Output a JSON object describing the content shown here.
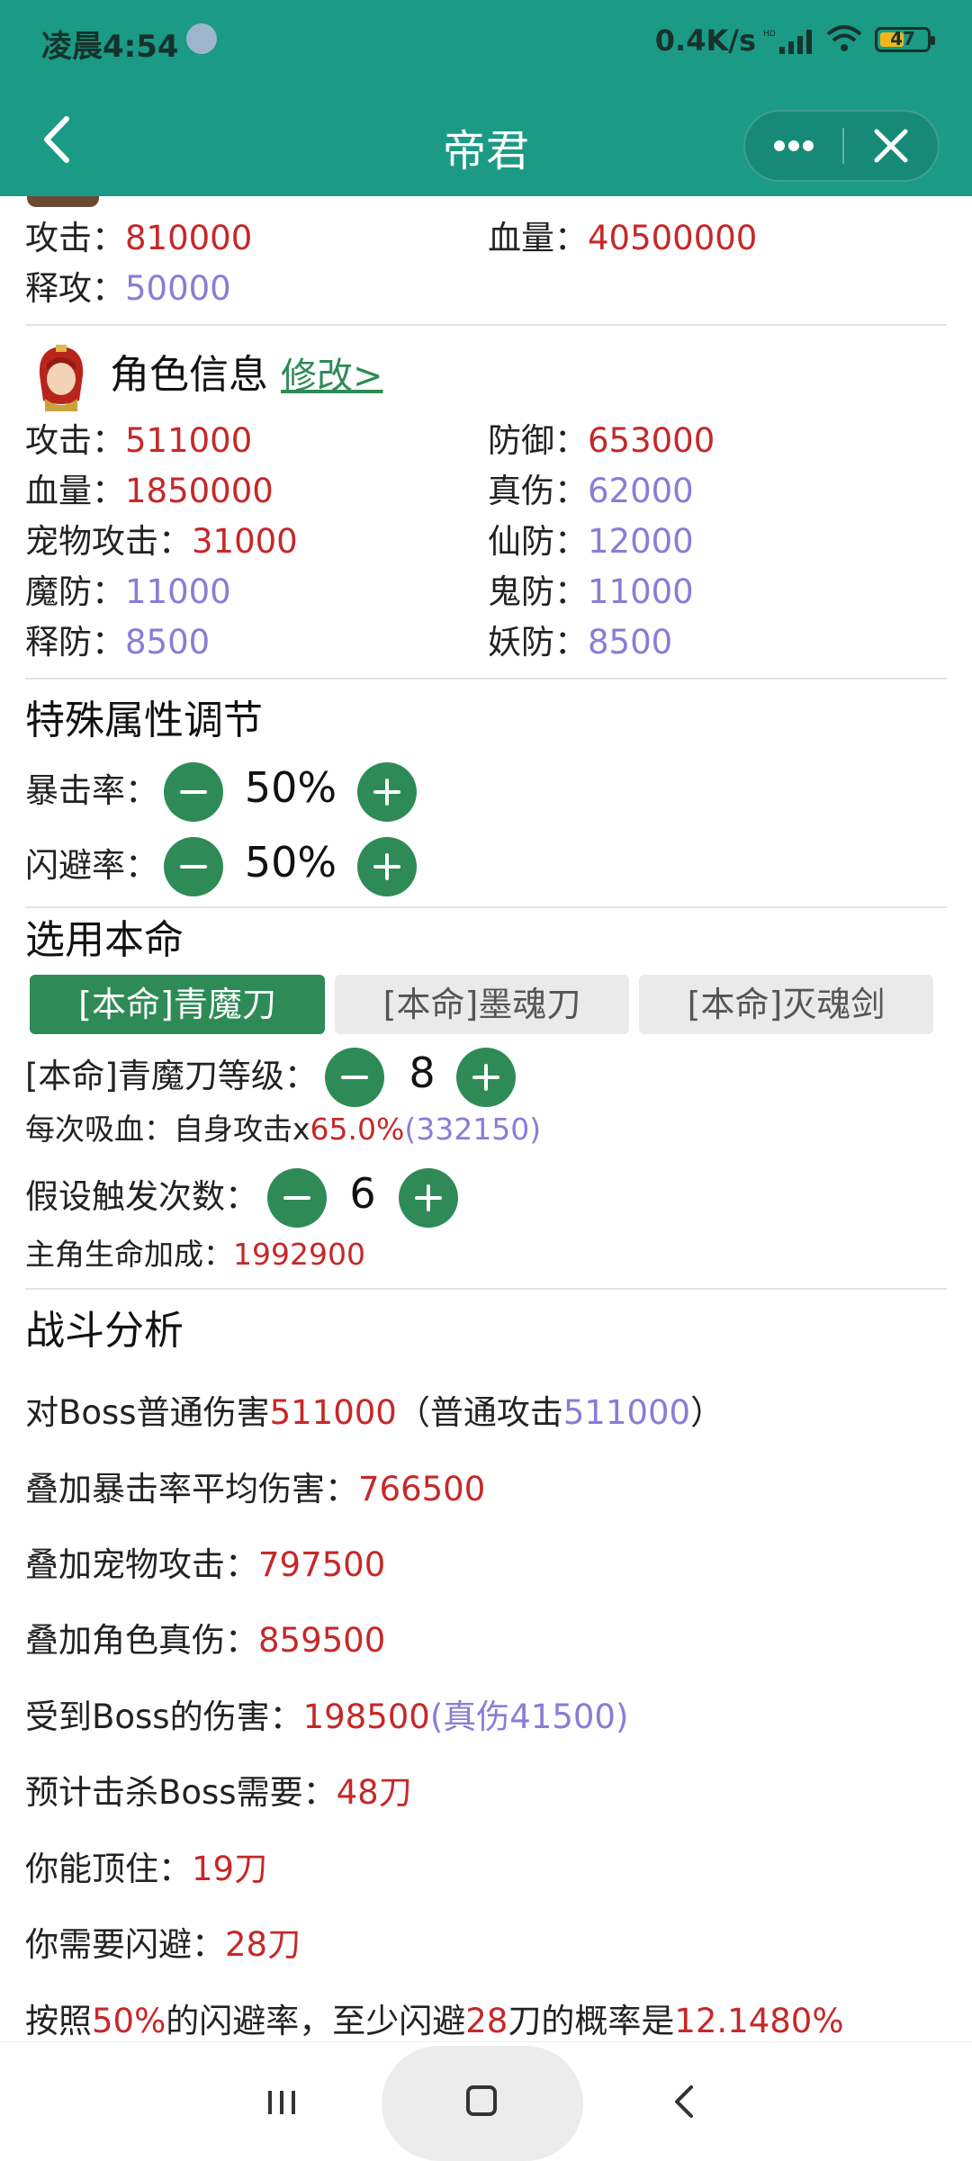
{
  "status": {
    "time": "凌晨4:54",
    "speed": "0.4K/s",
    "battery": "47",
    "network_badge": "HD"
  },
  "titlebar": {
    "title": "帝君"
  },
  "boss": {
    "attack_label": "攻击：",
    "attack": "810000",
    "hp_label": "血量：",
    "hp": "40500000",
    "release_label": "释攻：",
    "release": "50000"
  },
  "role": {
    "title": "角色信息",
    "edit": "修改>",
    "stats": {
      "attack_label": "攻击：",
      "attack": "511000",
      "defense_label": "防御：",
      "defense": "653000",
      "hp_label": "血量：",
      "hp": "1850000",
      "true_dmg_label": "真伤：",
      "true_dmg": "62000",
      "pet_attack_label": "宠物攻击：",
      "pet_attack": "31000",
      "immortal_def_label": "仙防：",
      "immortal_def": "12000",
      "magic_def_label": "魔防：",
      "magic_def": "11000",
      "ghost_def_label": "鬼防：",
      "ghost_def": "11000",
      "release_def_label": "释防：",
      "release_def": "8500",
      "demon_def_label": "妖防：",
      "demon_def": "8500"
    }
  },
  "special": {
    "title": "特殊属性调节",
    "crit_label": "暴击率：",
    "crit_value": "50%",
    "dodge_label": "闪避率：",
    "dodge_value": "50%"
  },
  "benming": {
    "title": "选用本命",
    "tabs": [
      "[本命]青魔刀",
      "[本命]墨魂刀",
      "[本命]灭魂剑"
    ],
    "level_label": "[本命]青魔刀等级：",
    "level": "8",
    "lifesteal_prefix": "每次吸血：自身攻击x",
    "lifesteal_pct": "65.0%",
    "lifesteal_amount": "(332150)",
    "trigger_label": "假设触发次数：",
    "trigger": "6",
    "bonus_label": "主角生命加成：",
    "bonus": "1992900"
  },
  "analysis": {
    "title": "战斗分析",
    "l1_a": "对Boss普通伤害",
    "l1_v": "511000",
    "l1_b": "（普通攻击",
    "l1_v2": "511000",
    "l1_c": "）",
    "l2_label": "叠加暴击率平均伤害：",
    "l2_v": "766500",
    "l3_label": "叠加宠物攻击：",
    "l3_v": "797500",
    "l4_label": "叠加角色真伤：",
    "l4_v": "859500",
    "l5_label": "受到Boss的伤害：",
    "l5_v": "198500",
    "l5_extra": "(真伤41500)",
    "l6_label": "预计击杀Boss需要：",
    "l6_v": "48刀",
    "l7_label": "你能顶住：",
    "l7_v": "19刀",
    "l8_label": "你需要闪避：",
    "l8_v": "28刀",
    "l9_a": "按照",
    "l9_pct": "50%",
    "l9_b": "的闪避率，至少闪避",
    "l9_n": "28",
    "l9_c": "刀的概率是",
    "l9_prob": "12.1480%"
  },
  "colors": {
    "teal": "#1b9a85",
    "green": "#2e8b57",
    "red": "#c62828",
    "purple": "#8c7bd6"
  }
}
